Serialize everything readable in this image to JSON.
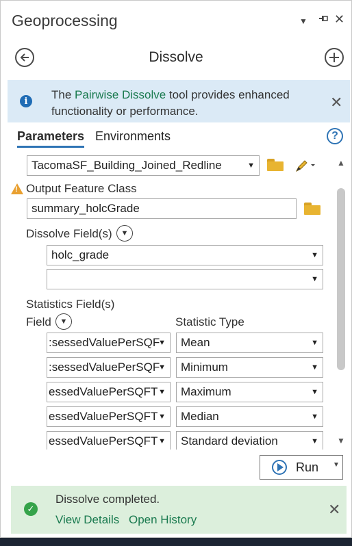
{
  "pane": {
    "title": "Geoprocessing",
    "dropdown_icon": "caret-down-icon",
    "pin_icon": "pin-icon",
    "close_icon": "close-icon"
  },
  "tool": {
    "title": "Dissolve",
    "back_icon": "back-arrow-icon",
    "add_icon": "plus-icon"
  },
  "info_banner": {
    "prefix": "The ",
    "link": "Pairwise Dissolve",
    "suffix": " tool provides enhanced functionality or performance."
  },
  "tabs": {
    "parameters": "Parameters",
    "environments": "Environments",
    "help": "?"
  },
  "params": {
    "input_features_value": "TacomaSF_Building_Joined_Redline",
    "output_label": "Output Feature Class",
    "output_value": "summary_holcGrade",
    "dissolve_label": "Dissolve Field(s)",
    "dissolve_fields": [
      "holc_grade",
      ""
    ],
    "statistics_label": "Statistics Field(s)",
    "field_col_label": "Field",
    "stat_col_label": "Statistic Type",
    "stat_rows": [
      {
        "field": ":sessedValuePerSQF",
        "stat": "Mean"
      },
      {
        "field": ":sessedValuePerSQF",
        "stat": "Minimum"
      },
      {
        "field": "essedValuePerSQFT",
        "stat": "Maximum"
      },
      {
        "field": "essedValuePerSQFT",
        "stat": "Median"
      },
      {
        "field": "essedValuePerSQFT",
        "stat": "Standard deviation"
      }
    ]
  },
  "run": {
    "label": "Run"
  },
  "status": {
    "message": "Dissolve completed.",
    "view_details": "View Details",
    "open_history": "Open History"
  },
  "colors": {
    "accent": "#2f74b5",
    "link": "#1a7a4f",
    "info_bg": "#dbeaf6",
    "success_bg": "#dcefdc",
    "warning": "#e9a030",
    "folder": "#e8b431"
  }
}
